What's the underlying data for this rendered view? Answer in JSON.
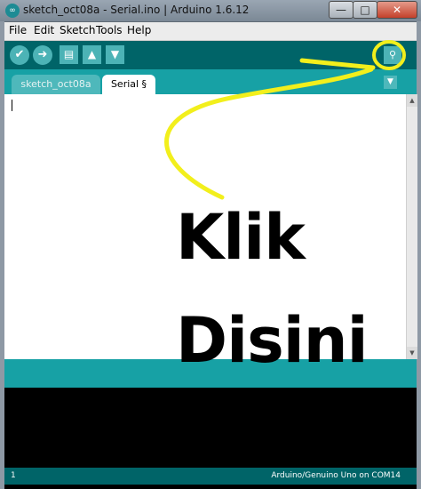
{
  "window": {
    "title": "sketch_oct08a - Serial.ino | Arduino 1.6.12",
    "app_icon": "arduino-icon",
    "controls": {
      "minimize": "—",
      "maximize": "□",
      "close": "✕"
    }
  },
  "menu": {
    "items": [
      "File",
      "Edit",
      "Sketch",
      "Tools",
      "Help"
    ]
  },
  "toolbar": {
    "verify_icon": "✔",
    "upload_icon": "➜",
    "new_icon": "▤",
    "open_icon": "▲",
    "save_icon": "▼",
    "serial_monitor_icon": "⚲"
  },
  "tabs": {
    "items": [
      {
        "label": "sketch_oct08a"
      },
      {
        "label": "Serial §"
      }
    ],
    "menu_icon": "▼"
  },
  "status": {
    "line": "1",
    "board": "Arduino/Genuino Uno on COM14"
  },
  "annotation": {
    "line1": "Klik",
    "line2": "Disini",
    "highlight_color": "#f2ef1c"
  }
}
